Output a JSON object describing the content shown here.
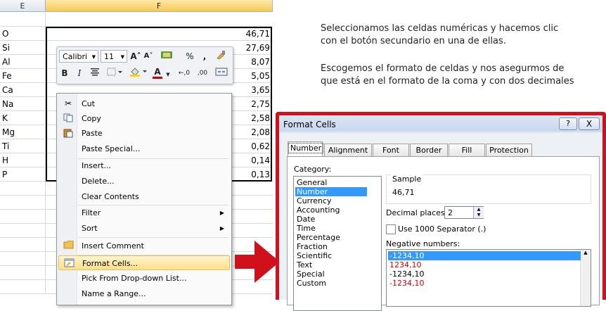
{
  "sheet": {
    "col_e": "E",
    "col_f": "F",
    "rows": [
      {
        "label": "O",
        "value": "46,71"
      },
      {
        "label": "Si",
        "value": "27,69"
      },
      {
        "label": "Al",
        "value": "8,07"
      },
      {
        "label": "Fe",
        "value": "5,05"
      },
      {
        "label": "Ca",
        "value": "3,65"
      },
      {
        "label": "Na",
        "value": "2,75"
      },
      {
        "label": "K",
        "value": "2,58"
      },
      {
        "label": "Mg",
        "value": "2,08"
      },
      {
        "label": "Ti",
        "value": "0,62"
      },
      {
        "label": "H",
        "value": "0,14"
      },
      {
        "label": "P",
        "value": "0,13"
      }
    ]
  },
  "mini_toolbar": {
    "font_name": "Calibri",
    "font_size": "11",
    "grow": "A˄",
    "shrink": "A˅",
    "percent": "%",
    "comma": ",",
    "bold": "B",
    "italic": "I",
    "font_color": "A",
    "inc_decimal": "←,0",
    "dec_decimal": ",00"
  },
  "context_menu": {
    "items": [
      {
        "label": "Cut",
        "icon": "scissors-icon"
      },
      {
        "label": "Copy",
        "icon": "copy-icon"
      },
      {
        "label": "Paste",
        "icon": "paste-icon"
      },
      {
        "label": "Paste Special..."
      },
      {
        "label": "Insert..."
      },
      {
        "label": "Delete..."
      },
      {
        "label": "Clear Contents"
      },
      {
        "label": "Filter"
      },
      {
        "label": "Sort"
      },
      {
        "label": "Insert Comment",
        "icon": "comment-icon"
      },
      {
        "label": "Format Cells...",
        "icon": "format-cells-icon"
      },
      {
        "label": "Pick From Drop-down List..."
      },
      {
        "label": "Name a Range..."
      }
    ]
  },
  "instructions": {
    "para1_line1": "Seleccionamos las celdas numéricas y hacemos clic",
    "para1_line2": "con el botón secundario en una de ellas.",
    "para2_line1": "Escogemos el formato de celdas y nos asegurmos de",
    "para2_line2": "que está en el formato de la coma y con dos decimales"
  },
  "dialog": {
    "title": "Format Cells",
    "help": "?",
    "close": "X",
    "tabs": [
      "Number",
      "Alignment",
      "Font",
      "Border",
      "Fill",
      "Protection"
    ],
    "category_label": "Category:",
    "categories": [
      "General",
      "Number",
      "Currency",
      "Accounting",
      "Date",
      "Time",
      "Percentage",
      "Fraction",
      "Scientific",
      "Text",
      "Special",
      "Custom"
    ],
    "selected_category": "Number",
    "sample_label": "Sample",
    "sample_value": "46,71",
    "decimal_label": "Decimal places:",
    "decimal_value": "2",
    "separator_label": "Use 1000 Separator (.)",
    "negative_label": "Negative numbers:",
    "negative_options": [
      "-1234,10",
      "1234,10",
      "-1234,10",
      "-1234,10"
    ]
  },
  "colors": {
    "highlight_red": "#d0101a",
    "neg_red": "#d00000",
    "selection_blue": "#3399ff"
  }
}
